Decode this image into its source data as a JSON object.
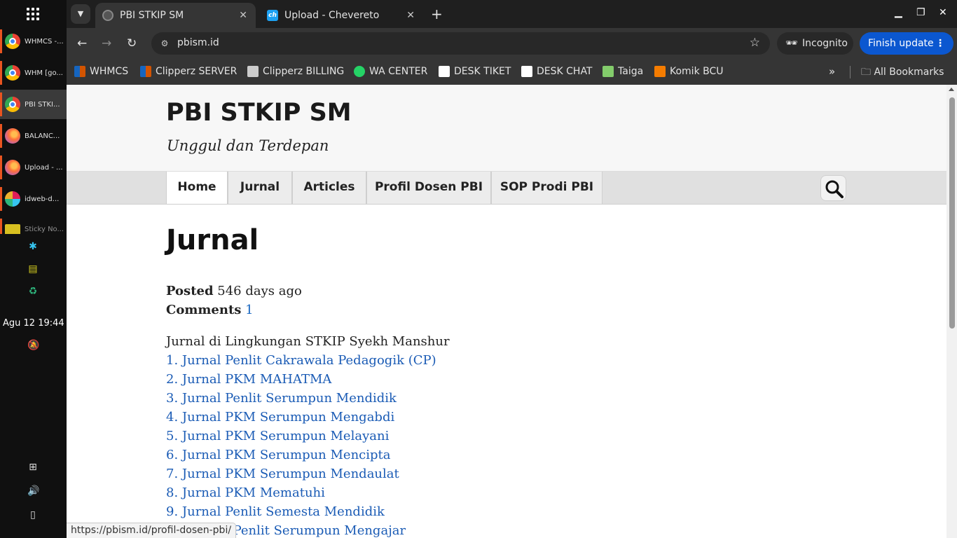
{
  "os": {
    "clock": "Agu 12  19:44",
    "taskbar_items": [
      {
        "label": "WHMCS -...",
        "icon": "chrome-icon"
      },
      {
        "label": "WHM [go...",
        "icon": "chrome-icon"
      },
      {
        "label": "PBI STKI...",
        "icon": "chrome-icon"
      },
      {
        "label": "BALANC...",
        "icon": "firefox-icon"
      },
      {
        "label": "Upload - ...",
        "icon": "firefox-icon"
      },
      {
        "label": "idweb-d...",
        "icon": "slack-icon"
      },
      {
        "label": "Sticky No...",
        "icon": "sticky-notes-icon"
      }
    ]
  },
  "browser": {
    "tabs": [
      {
        "title": "PBI STKIP SM",
        "active": true
      },
      {
        "title": "Upload - Chevereto",
        "active": false
      }
    ],
    "favicon_text_chevereto": "ch",
    "url": "pbism.id",
    "incognito_label": "Incognito",
    "finish_update_label": "Finish update",
    "bookmarks": [
      {
        "label": "WHMCS",
        "color": "#d35400"
      },
      {
        "label": "Clipperz SERVER",
        "color": "#d35400"
      },
      {
        "label": "Clipperz BILLING",
        "color": "#cccccc"
      },
      {
        "label": "WA CENTER",
        "color": "#25d366"
      },
      {
        "label": "DESK TIKET",
        "color": "#ffffff"
      },
      {
        "label": "DESK CHAT",
        "color": "#ffffff"
      },
      {
        "label": "Taiga",
        "color": "#83cc6b"
      },
      {
        "label": "Komik BCU",
        "color": "#f57c00"
      }
    ],
    "all_bookmarks_label": "All Bookmarks",
    "status_url": "https://pbism.id/profil-dosen-pbi/"
  },
  "site": {
    "title": "PBI STKIP SM",
    "tagline": "Unggul dan Terdepan",
    "menu": [
      "Home",
      "Jurnal",
      "Articles",
      "Profil Dosen PBI",
      "SOP Prodi PBI"
    ],
    "current_menu": "Home"
  },
  "page": {
    "title": "Jurnal",
    "posted_label": "Posted",
    "posted_value": "546 days ago",
    "comments_label": "Comments",
    "comments_value": "1",
    "intro": "Jurnal di Lingkungan STKIP Syekh Manshur",
    "journals": [
      "1. Jurnal Penlit Cakrawala Pedagogik (CP)",
      "2. Jurnal PKM MAHATMA",
      "3. Jurnal Penlit Serumpun Mendidik",
      "4. Jurnal PKM Serumpun Mengabdi",
      "5. Jurnal PKM Serumpun Melayani",
      "6. Jurnal PKM Serumpun Mencipta",
      "7. Jurnal PKM Serumpun Mendaulat",
      "8. Jurnal PKM Mematuhi",
      "9. Jurnal Penlit Semesta Mendidik",
      "10. Jurnal Penlit Serumpun Mengajar"
    ]
  }
}
